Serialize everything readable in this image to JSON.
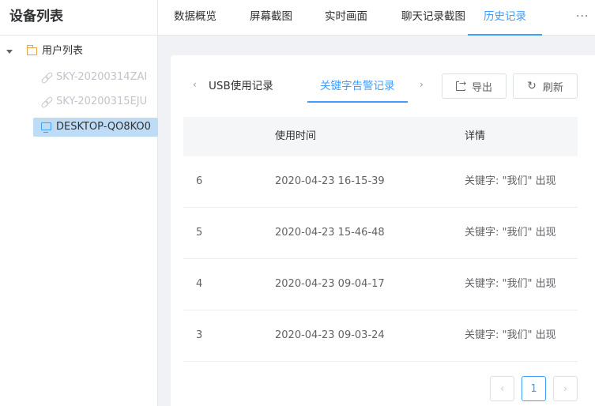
{
  "sidebar": {
    "title": "设备列表",
    "tree": {
      "root_label": "用户列表",
      "children": [
        {
          "label": "SKY-20200314ZAI"
        },
        {
          "label": "SKY-20200315EJU"
        },
        {
          "label": "DESKTOP-QO8KO0"
        }
      ]
    }
  },
  "top_tabs": [
    "数据概览",
    "屏幕截图",
    "实时画面",
    "聊天记录截图",
    "历史记录"
  ],
  "top_tabs_more": "···",
  "subtabs": {
    "prev_arrow": "‹",
    "next_arrow": "›",
    "items": [
      "USB使用记录",
      "关键字告警记录"
    ]
  },
  "buttons": {
    "export": "导出",
    "refresh": "刷新"
  },
  "table": {
    "headers": [
      "",
      "使用时间",
      "详情"
    ],
    "rows": [
      [
        "6",
        "2020-04-23 16-15-39",
        "关键字: \"我们\" 出现"
      ],
      [
        "5",
        "2020-04-23 15-46-48",
        "关键字: \"我们\" 出现"
      ],
      [
        "4",
        "2020-04-23 09-04-17",
        "关键字: \"我们\" 出现"
      ],
      [
        "3",
        "2020-04-23 09-03-24",
        "关键字: \"我们\" 出现"
      ]
    ]
  },
  "pagination": {
    "prev": "‹",
    "current": "1",
    "next": "›"
  },
  "colors": {
    "accent": "#409eff",
    "selected_bg": "#bfdcf7",
    "folder": "#e6a23c"
  }
}
